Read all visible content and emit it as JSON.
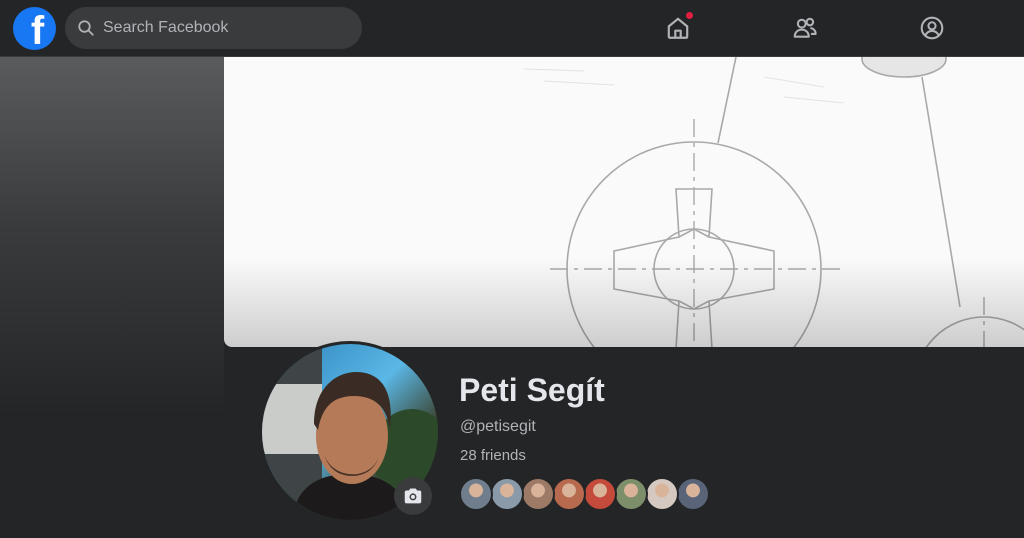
{
  "app": {
    "logo_letter": "f"
  },
  "search": {
    "placeholder": "Search Facebook"
  },
  "nav": {
    "items": [
      {
        "name": "home",
        "icon": "home-icon",
        "has_notification": true
      },
      {
        "name": "friends",
        "icon": "friends-icon"
      },
      {
        "name": "account",
        "icon": "account-icon"
      }
    ]
  },
  "profile": {
    "name": "Peti Segít",
    "handle": "@petisegit",
    "friends_label": "28 friends"
  },
  "friend_avatars": [
    {
      "color": "#6f7d8c"
    },
    {
      "color": "#8a9aa8"
    },
    {
      "color": "#9c7a66"
    },
    {
      "color": "#b86a4e"
    },
    {
      "color": "#c44a3c"
    },
    {
      "color": "#7d8f6a"
    },
    {
      "color": "#d4c8c0"
    },
    {
      "color": "#5a6478"
    }
  ],
  "colors": {
    "brand": "#1877f2",
    "background": "#242526",
    "surface": "#3a3b3c",
    "text_primary": "#e4e6eb",
    "text_secondary": "#b0b3b8",
    "notification": "#e41e3f"
  }
}
